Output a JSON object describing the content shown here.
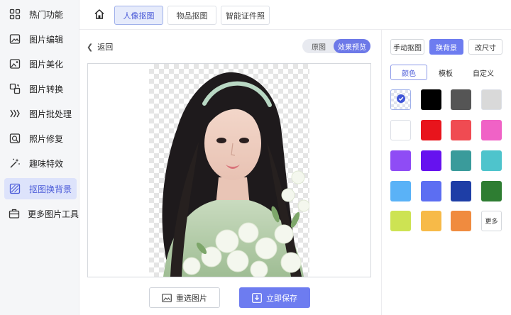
{
  "sidebar": {
    "items": [
      {
        "label": "热门功能",
        "icon": "hot-feature-icon"
      },
      {
        "label": "图片编辑",
        "icon": "image-edit-icon"
      },
      {
        "label": "图片美化",
        "icon": "image-beautify-icon"
      },
      {
        "label": "图片转换",
        "icon": "image-convert-icon"
      },
      {
        "label": "图片批处理",
        "icon": "batch-process-icon"
      },
      {
        "label": "照片修复",
        "icon": "photo-repair-icon"
      },
      {
        "label": "趣味特效",
        "icon": "magic-wand-icon"
      },
      {
        "label": "抠图换背景",
        "icon": "cutout-background-icon"
      },
      {
        "label": "更多图片工具",
        "icon": "toolbox-icon"
      }
    ],
    "active_index": 7
  },
  "topbar": {
    "home_icon": "home-icon",
    "tabs": [
      {
        "label": "人像抠图"
      },
      {
        "label": "物品抠图"
      },
      {
        "label": "智能证件照"
      }
    ]
  },
  "main": {
    "back_label": "返回",
    "view_toggle": {
      "original": "原图",
      "preview": "效果预览"
    },
    "reselect_label": "重选图片",
    "save_label": "立即保存"
  },
  "right_panel": {
    "mode_buttons": [
      {
        "label": "手动抠图"
      },
      {
        "label": "换背景"
      },
      {
        "label": "改尺寸"
      }
    ],
    "sub_tabs": [
      {
        "label": "颜色"
      },
      {
        "label": "模板"
      },
      {
        "label": "自定义"
      }
    ],
    "selected_swatch": "transparent",
    "swatches": [
      "transparent",
      "#000000",
      "#555555",
      "#d9d9d9",
      "#ffffff",
      "#e8141c",
      "#f04b52",
      "#f062c6",
      "#8f4cf5",
      "#6612ef",
      "#3a9b9b",
      "#4ec4cc",
      "#5ab2f7",
      "#5c6ef2",
      "#1e3ea6",
      "#2e7d32",
      "#cde353",
      "#f7ba48",
      "#f08b3f"
    ],
    "more_label": "更多",
    "accent": "#6d7cf0"
  }
}
